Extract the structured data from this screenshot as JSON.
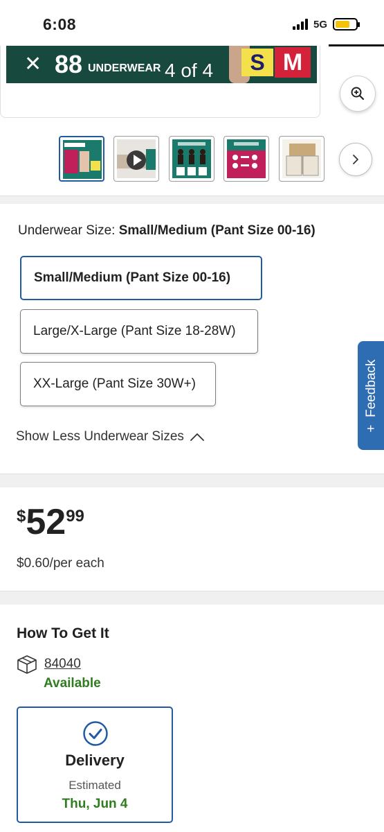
{
  "status_bar": {
    "time": "6:08",
    "network": "5G"
  },
  "gallery": {
    "banner": {
      "count": "88",
      "word": "UNDERWEAR",
      "size_s": "S",
      "size_m": "M",
      "close_symbol": "✕"
    },
    "counter": "4 of 4",
    "zoom_icon": "zoom-in-icon",
    "thumbnails": [
      {
        "name": "package-front",
        "kind": "image",
        "active": true
      },
      {
        "name": "product-video",
        "kind": "video",
        "active": false
      },
      {
        "name": "size-guide",
        "kind": "image",
        "active": false
      },
      {
        "name": "absorbency",
        "kind": "image",
        "active": false
      },
      {
        "name": "box-contents",
        "kind": "image",
        "active": false
      }
    ]
  },
  "size": {
    "label": "Underwear Size:",
    "selected": "Small/Medium (Pant Size 00-16)",
    "options": [
      "Small/Medium (Pant Size 00-16)",
      "Large/X-Large (Pant Size 18-28W)",
      "XX-Large (Pant Size 30W+)"
    ],
    "toggle_label": "Show Less Underwear Sizes"
  },
  "feedback": {
    "label": "Feedback",
    "plus": "+"
  },
  "pricing": {
    "dollar_sign": "$",
    "whole": "52",
    "cents": "99",
    "unit_price": "$0.60/per each"
  },
  "fulfillment": {
    "title": "How To Get It",
    "zip": "84040",
    "availability": "Available",
    "delivery": {
      "title": "Delivery",
      "estimated_label": "Estimated",
      "date": "Thu, Jun 4"
    }
  },
  "colors": {
    "accent_blue": "#1f5aa3",
    "available_green": "#2e7d1e",
    "banner_green": "#17493f"
  }
}
